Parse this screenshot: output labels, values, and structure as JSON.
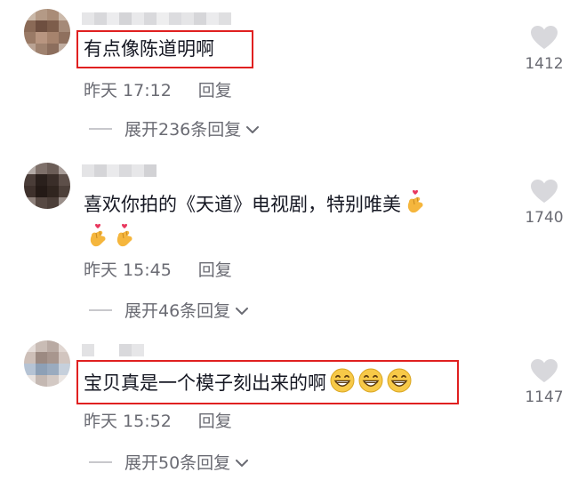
{
  "comments": [
    {
      "text": "有点像陈道明啊",
      "time": "昨天 17:12",
      "reply": "回复",
      "likes": "1412",
      "expand": "展开236条回复",
      "highlighted": true
    },
    {
      "text": "喜欢你拍的《天道》电视剧，特别唯美",
      "time": "昨天 15:45",
      "reply": "回复",
      "likes": "1740",
      "expand": "展开46条回复",
      "highlighted": false
    },
    {
      "text": "宝贝真是一个模子刻出来的啊",
      "time": "昨天 15:52",
      "reply": "回复",
      "likes": "1147",
      "expand": "展开50条回复",
      "highlighted": true
    }
  ],
  "colors": {
    "highlight_border": "#e02020",
    "text_primary": "#161823",
    "text_secondary": "#6a6b73",
    "heart_icon": "#d8d8dc"
  },
  "icons": {
    "like": "heart-icon",
    "expand": "chevron-down-icon",
    "emoji_comment2": "finger-heart-emoji",
    "emoji_comment3": "grinning-emoji"
  }
}
